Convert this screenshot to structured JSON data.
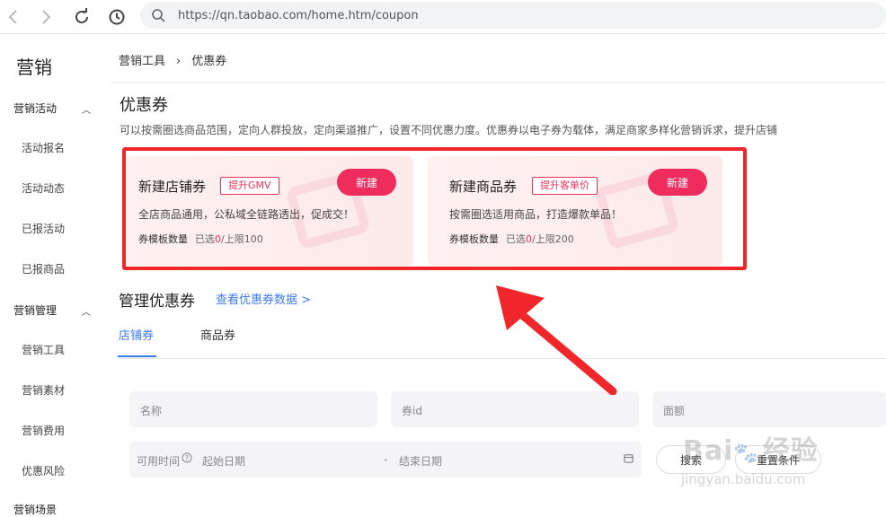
{
  "browser": {
    "url": "https://qn.taobao.com/home.htm/coupon"
  },
  "sidebar": {
    "title": "营销",
    "groups": [
      {
        "label": "营销活动",
        "items": [
          "活动报名",
          "活动动态",
          "已报活动",
          "已报商品"
        ]
      },
      {
        "label": "营销管理",
        "items": [
          "营销工具",
          "营销素材",
          "营销费用",
          "优惠风险"
        ]
      },
      {
        "label": "营销场景"
      }
    ]
  },
  "breadcrumb": {
    "parent": "营销工具",
    "sep": "›",
    "current": "优惠券"
  },
  "page": {
    "title": "优惠券",
    "description": "可以按需圈选商品范围，定向人群投放，定向渠道推广，设置不同优惠力度。优惠券以电子券为载体，满足商家多样化营销诉求，提升店铺"
  },
  "cards": [
    {
      "title": "新建店铺券",
      "tag": "提升GMV",
      "button": "新建",
      "desc": "全店商品通用，公私域全链路透出，促成交！",
      "quota_label": "券模板数量",
      "quota_pre": "已选",
      "quota_count": "0",
      "quota_post": "/上限100"
    },
    {
      "title": "新建商品券",
      "tag": "提升客单价",
      "button": "新建",
      "desc": "按需圈选适用商品，打造爆款单品！",
      "quota_label": "券模板数量",
      "quota_pre": "已选",
      "quota_count": "0",
      "quota_post": "/上限200"
    }
  ],
  "manage": {
    "title": "管理优惠券",
    "link": "查看优惠券数据 >",
    "tabs": [
      "店铺券",
      "商品券"
    ]
  },
  "filters": {
    "name_placeholder": "名称",
    "id_placeholder": "券id",
    "amount_placeholder": "面额",
    "time_label": "可用时间",
    "start_placeholder": "起始日期",
    "date_sep": "-",
    "end_placeholder": "结束日期",
    "search_btn": "搜索",
    "reset_btn": "重置条件"
  },
  "watermark": {
    "brand": "Bai",
    "brand_cn": "经验",
    "url": "jingyan.baidu.com"
  },
  "colors": {
    "accent": "#ee2d5e",
    "link": "#3b7bf0",
    "highlight_frame": "#f0262b"
  }
}
